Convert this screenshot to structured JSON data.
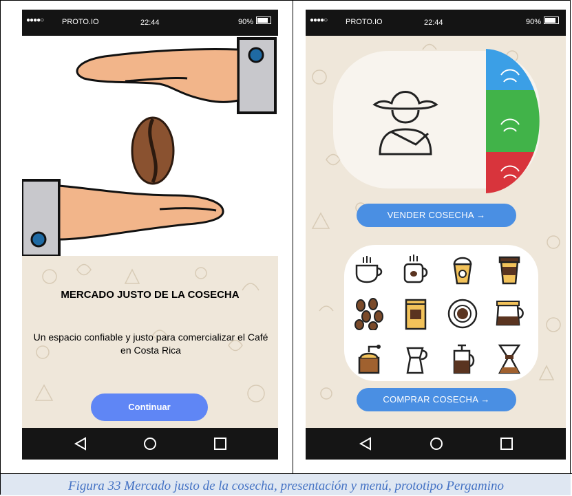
{
  "screen_left": {
    "status": {
      "carrier": "PROTO.IO",
      "time": "22:44",
      "battery": "90%",
      "signal_dots": "●●●●○"
    },
    "title": "MERCADO JUSTO DE LA COSECHA",
    "subtitle": "Un espacio confiable y justo para comercializar el Café en Costa Rica",
    "continue_label": "Continuar"
  },
  "screen_right": {
    "status": {
      "carrier": "PROTO.IO",
      "time": "22:44",
      "battery": "90%",
      "signal_dots": "●●●●○"
    },
    "sell_label": "VENDER COSECHA  →",
    "buy_label": "COMPRAR COSECHA  →",
    "wheel_colors": [
      "#3b9fe6",
      "#41b349",
      "#d8343c"
    ],
    "coffee_icons": [
      "coffee-cup-icon",
      "mug-icon",
      "frappe-icon",
      "takeaway-cup-icon",
      "coffee-beans-icon",
      "coffee-bag-icon",
      "cup-top-view-icon",
      "coffee-pot-icon",
      "grinder-icon",
      "moka-pot-icon",
      "french-press-icon",
      "chemex-icon"
    ]
  },
  "caption": "Figura 33 Mercado justo de la cosecha, presentación y menú, prototipo Pergamino",
  "colors": {
    "accent_blue": "#5f86f5",
    "pill_blue": "#4a8fe3",
    "background_beige": "#efe7da",
    "caption_color": "#4472c4"
  }
}
